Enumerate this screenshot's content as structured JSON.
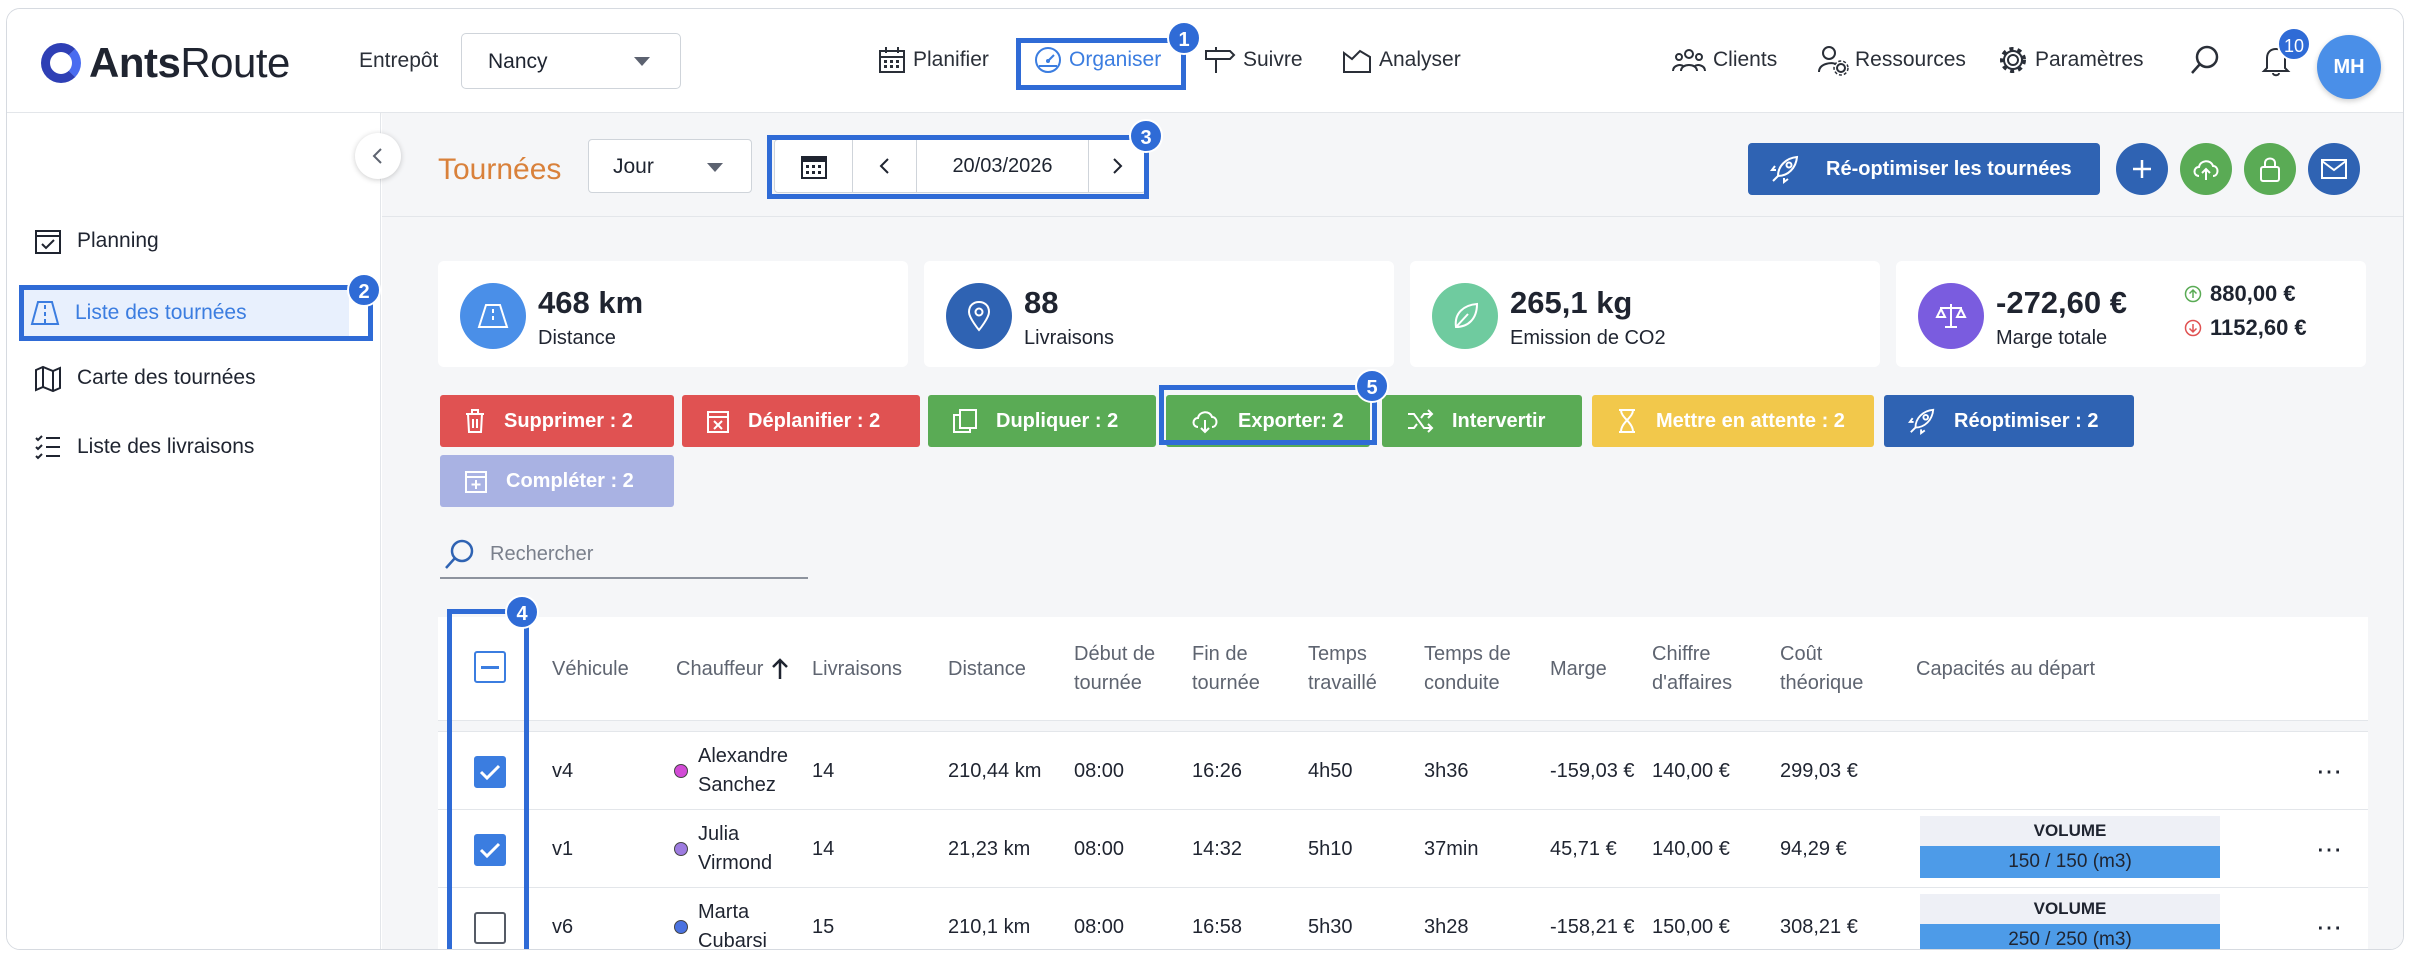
{
  "header": {
    "logo_bold": "Ants",
    "logo_light": "Route",
    "warehouse_label": "Entrepôt",
    "warehouse_value": "Nancy",
    "nav": [
      {
        "label": "Planifier",
        "icon": "calendar-icon"
      },
      {
        "label": "Organiser",
        "icon": "dashboard-icon",
        "active": true
      },
      {
        "label": "Suivre",
        "icon": "signpost-icon"
      },
      {
        "label": "Analyser",
        "icon": "chart-icon"
      }
    ],
    "right_nav": [
      {
        "label": "Clients",
        "icon": "users-icon"
      },
      {
        "label": "Ressources",
        "icon": "user-gear-icon"
      },
      {
        "label": "Paramètres",
        "icon": "gear-icon"
      }
    ],
    "notifications": "10",
    "avatar_initials": "MH"
  },
  "sidebar": {
    "items": [
      {
        "label": "Planning",
        "icon": "calendar-check-icon"
      },
      {
        "label": "Liste des tournées",
        "icon": "road-icon",
        "active": true
      },
      {
        "label": "Carte des tournées",
        "icon": "map-icon"
      },
      {
        "label": "Liste des livraisons",
        "icon": "list-icon"
      }
    ]
  },
  "toolbar": {
    "title": "Tournées",
    "view": "Jour",
    "date": "20/03/2026",
    "reoptimize_label": "Ré-optimiser les tournées"
  },
  "stats": {
    "distance": {
      "value": "468 km",
      "label": "Distance"
    },
    "deliveries": {
      "value": "88",
      "label": "Livraisons"
    },
    "co2": {
      "value": "265,1 kg",
      "label": "Emission de CO2"
    },
    "margin": {
      "value": "-272,60 €",
      "label": "Marge totale",
      "up": "880,00 €",
      "down": "1152,60 €"
    }
  },
  "actions": [
    {
      "label": "Supprimer : 2",
      "color": "#e05252"
    },
    {
      "label": "Déplanifier : 2",
      "color": "#e05252"
    },
    {
      "label": "Dupliquer : 2",
      "color": "#5aab55"
    },
    {
      "label": "Exporter: 2",
      "color": "#5aab55"
    },
    {
      "label": "Intervertir",
      "color": "#5aab55"
    },
    {
      "label": "Mettre en attente : 2",
      "color": "#f2c84b"
    },
    {
      "label": "Réoptimiser : 2",
      "color": "#2f63b3"
    },
    {
      "label": "Compléter : 2",
      "color": "#a9b2e3"
    }
  ],
  "search": {
    "placeholder": "Rechercher"
  },
  "table": {
    "columns": {
      "vehicle": "Véhicule",
      "driver": "Chauffeur",
      "deliveries": "Livraisons",
      "distance": "Distance",
      "start": "Début de tournée",
      "end": "Fin de tournée",
      "worked": "Temps travaillé",
      "driving": "Temps de conduite",
      "margin": "Marge",
      "revenue": "Chiffre d'affaires",
      "cost": "Coût théorique",
      "capacity": "Capacités au départ"
    },
    "rows": [
      {
        "checked": true,
        "vehicle": "v4",
        "driver": "Alexandre Sanchez",
        "driver_color": "#d24bd6",
        "deliveries": "14",
        "distance": "210,44 km",
        "start": "08:00",
        "end": "16:26",
        "worked": "4h50",
        "driving": "3h36",
        "margin": "-159,03 €",
        "revenue": "140,00 €",
        "cost": "299,03 €",
        "capacity": null
      },
      {
        "checked": true,
        "vehicle": "v1",
        "driver": "Julia Virmond",
        "driver_color": "#9d7be0",
        "deliveries": "14",
        "distance": "21,23 km",
        "start": "08:00",
        "end": "14:32",
        "worked": "5h10",
        "driving": "37min",
        "margin": "45,71 €",
        "revenue": "140,00 €",
        "cost": "94,29 €",
        "capacity": {
          "label": "VOLUME",
          "value": "150 / 150 (m3)",
          "fill": 1.0
        }
      },
      {
        "checked": false,
        "vehicle": "v6",
        "driver": "Marta Cubarsi",
        "driver_color": "#4a72e0",
        "deliveries": "15",
        "distance": "210,1 km",
        "start": "08:00",
        "end": "16:58",
        "worked": "5h30",
        "driving": "3h28",
        "margin": "-158,21 €",
        "revenue": "150,00 €",
        "cost": "308,21 €",
        "capacity": {
          "label": "VOLUME",
          "value": "250 / 250 (m3)",
          "fill": 1.0
        }
      }
    ]
  },
  "annotations": [
    "1",
    "2",
    "3",
    "4",
    "5"
  ],
  "colors": {
    "accent": "#3b7de0",
    "highlight": "#2f6bd6",
    "title": "#d9813b"
  }
}
